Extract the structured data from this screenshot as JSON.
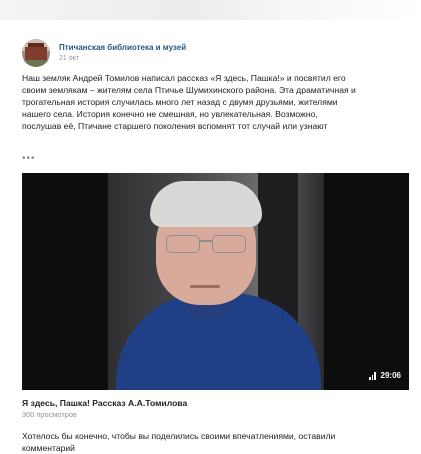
{
  "post": {
    "author": "Птичанская библиотека и музей",
    "date": "21 окт",
    "text_lines": [
      "Наш земляк Андрей Томилов написал рассказ «Я здесь, Пашка!» и посвятил его",
      "своим землякам – жителям села Птичье Шумихинского района. Эта драматичная и",
      "трогательная история случилась много лет назад с двумя друзьями, жителями",
      "нашего села. История конечно не смешная, но увлекательная. Возможно,",
      "послушав  её,  Птичане старшего поколения  вспомнят тот случай или узнают"
    ],
    "more": "•••"
  },
  "video": {
    "duration": "29:06",
    "title": "Я здесь, Пашка! Рассказ А.А.Томилова",
    "views": "300 просмотров"
  },
  "footer": {
    "text_lines": [
      "Хотелось бы конечно, чтобы вы поделились своими впечатлениями, оставили",
      "комментарий"
    ]
  },
  "colors": {
    "author_link": "#2a5885",
    "muted": "#939393",
    "text": "#222222",
    "video_bg": "#0d0d0d",
    "shirt": "#1f3f86"
  },
  "icons": {
    "avatar": "library-building-avatar",
    "duration": "signal-bars-icon"
  }
}
